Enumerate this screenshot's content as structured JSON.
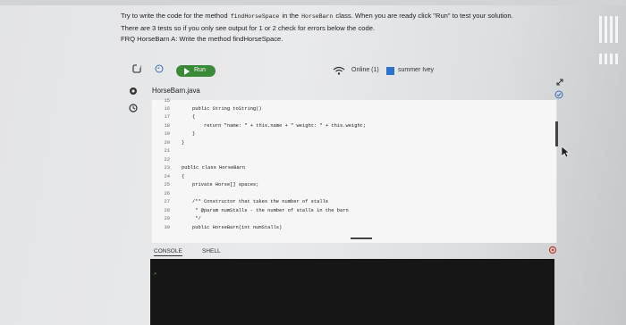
{
  "instructions": {
    "line1_pre": "Try to write the code for the method",
    "method_code": "findHorseSpace",
    "line1_mid": "in the",
    "class_code": "HorseBarn",
    "line1_post": "class. When you are ready click \"Run\" to test your solution.",
    "line2": "There are 3 tests so if you only see output for 1 or 2 check for errors below the code.",
    "line3": "FRQ HorseBarn A: Write the method findHorseSpace."
  },
  "toolbar": {
    "run_label": "Run",
    "online_label": "Online (1)",
    "user_name": "summer Ivey",
    "refresh_icon": "refresh-icon",
    "history_icon": "history-icon",
    "wifi_icon": "wifi-icon"
  },
  "file": {
    "name": "HorseBarn.java"
  },
  "editor": {
    "line_numbers": [
      "15",
      "16",
      "17",
      "18",
      "19",
      "20",
      "21",
      "22",
      "23",
      "24",
      "25",
      "26",
      "27",
      "28",
      "29",
      "30"
    ],
    "code": {
      "l16": "public String toString()",
      "l17": "{",
      "l18": "return \"name: \" + this.name + \" weight: \" + this.weight;",
      "l19": "}",
      "l20": "}",
      "l23": "public class HorseBarn",
      "l24": "{",
      "l25": "private Horse[] spaces;",
      "l27": "/** Constructor that takes the number of stalls",
      "l28": " * @param numStalls - the number of stalls in the barn",
      "l29": " */",
      "l30": "public HorseBarn(int numStalls)"
    }
  },
  "console": {
    "tabs": [
      "CONSOLE",
      "SHELL"
    ],
    "prompt": ">"
  },
  "colors": {
    "run_green": "#3a8a3a",
    "user_blue": "#2f73c7",
    "console_bg": "#161616"
  }
}
